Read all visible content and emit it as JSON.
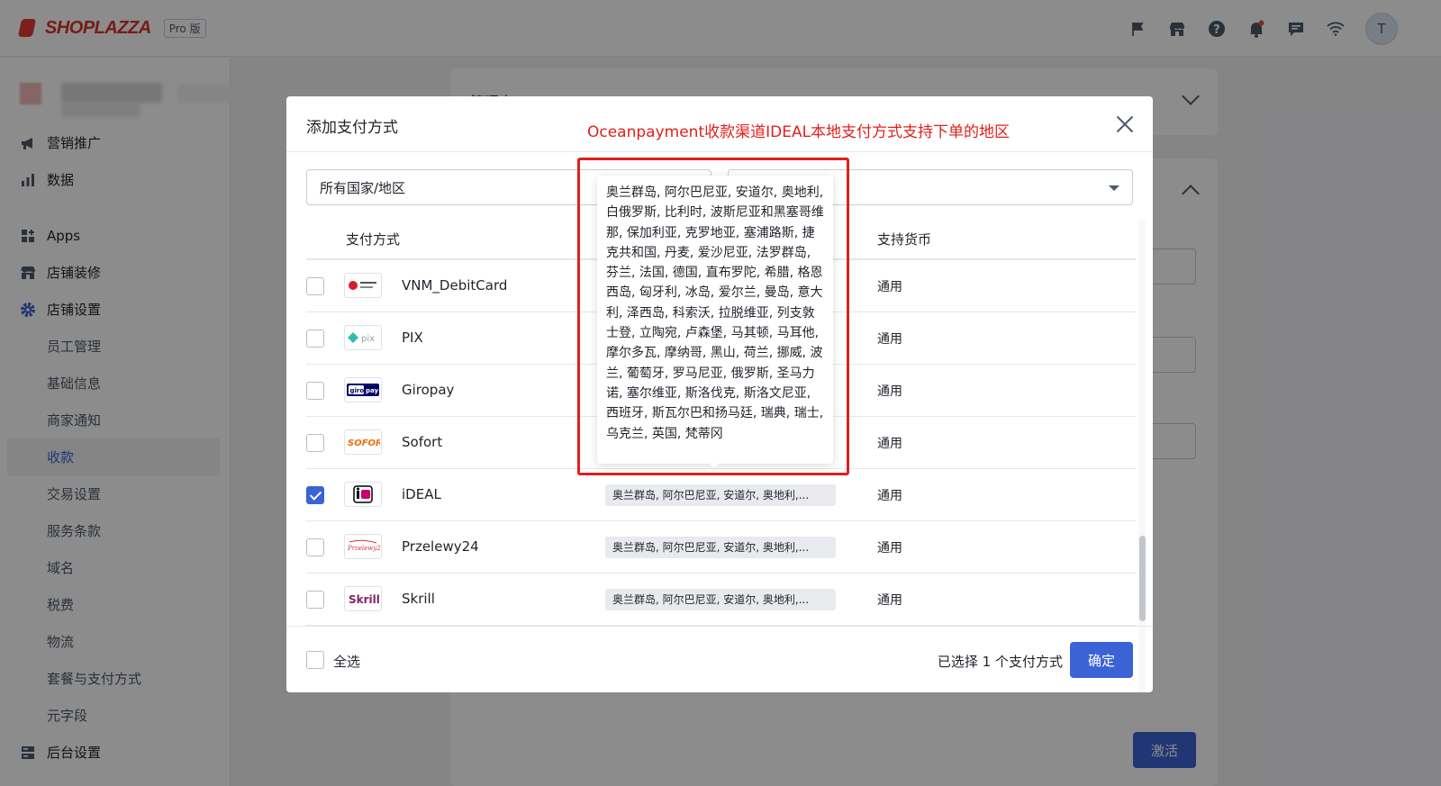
{
  "app": {
    "logo_text": "SHOPLAZZA",
    "plan_badge": "Pro 版",
    "avatar_initial": "T"
  },
  "sidebar": {
    "items": [
      {
        "label": "营销推广",
        "icon": "megaphone-icon"
      },
      {
        "label": "数据",
        "icon": "bar-chart-icon"
      },
      {
        "label": "Apps",
        "icon": "apps-icon"
      },
      {
        "label": "店铺装修",
        "icon": "store-icon"
      },
      {
        "label": "店铺设置",
        "icon": "gear-icon"
      },
      {
        "label": "员工管理"
      },
      {
        "label": "基础信息"
      },
      {
        "label": "商家通知"
      },
      {
        "label": "收款"
      },
      {
        "label": "交易设置"
      },
      {
        "label": "服务条款"
      },
      {
        "label": "域名"
      },
      {
        "label": "税费"
      },
      {
        "label": "物流"
      },
      {
        "label": "套餐与支付方式"
      },
      {
        "label": "元字段"
      },
      {
        "label": "后台设置",
        "icon": "server-icon"
      }
    ]
  },
  "background": {
    "card_title": "管理支",
    "activate_label": "激活"
  },
  "modal": {
    "title": "添加支付方式",
    "annotation": "Oceanpayment收款渠道IDEAL本地支付方式支持下单的地区",
    "country_filter": "所有国家/地区",
    "columns": {
      "method": "支付方式",
      "currency": "支持货币"
    },
    "rows": [
      {
        "name": "VNM_DebitCard",
        "currency": "通用",
        "checked": false,
        "logo": "vnm-debitcard-logo"
      },
      {
        "name": "PIX",
        "currency": "通用",
        "checked": false,
        "logo": "pix-logo"
      },
      {
        "name": "Giropay",
        "currency": "通用",
        "checked": false,
        "logo": "giropay-logo"
      },
      {
        "name": "Sofort",
        "currency": "通用",
        "checked": false,
        "logo": "sofort-logo"
      },
      {
        "name": "iDEAL",
        "currency": "通用",
        "checked": true,
        "logo": "ideal-logo",
        "regions": "奥兰群岛, 阿尔巴尼亚, 安道尔, 奥地利,..."
      },
      {
        "name": "Przelewy24",
        "currency": "通用",
        "checked": false,
        "logo": "przelewy24-logo",
        "regions": "奥兰群岛, 阿尔巴尼亚, 安道尔, 奥地利,..."
      },
      {
        "name": "Skrill",
        "currency": "通用",
        "checked": false,
        "logo": "skrill-logo",
        "regions": "奥兰群岛, 阿尔巴尼亚, 安道尔, 奥地利,..."
      }
    ],
    "tooltip_regions": "奥兰群岛, 阿尔巴尼亚, 安道尔, 奥地利, 白俄罗斯, 比利时, 波斯尼亚和黑塞哥维那, 保加利亚, 克罗地亚, 塞浦路斯, 捷克共和国, 丹麦, 爱沙尼亚, 法罗群岛, 芬兰, 法国, 德国, 直布罗陀, 希腊, 格恩西岛, 匈牙利, 冰岛, 爱尔兰, 曼岛, 意大利, 泽西岛, 科索沃, 拉脱维亚, 列支敦士登, 立陶宛, 卢森堡, 马其顿, 马耳他, 摩尔多瓦, 摩纳哥, 黑山, 荷兰, 挪威, 波兰, 葡萄牙, 罗马尼亚, 俄罗斯, 圣马力诺, 塞尔维亚, 斯洛伐克, 斯洛文尼亚, 西班牙, 斯瓦尔巴和扬马廷, 瑞典, 瑞士, 乌克兰, 英国, 梵蒂冈",
    "footer": {
      "select_all": "全选",
      "selected_count": "已选择 1 个支付方式",
      "confirm": "确定"
    }
  },
  "colors": {
    "accent": "#3b63d6",
    "annotation_red": "#e0201b"
  }
}
